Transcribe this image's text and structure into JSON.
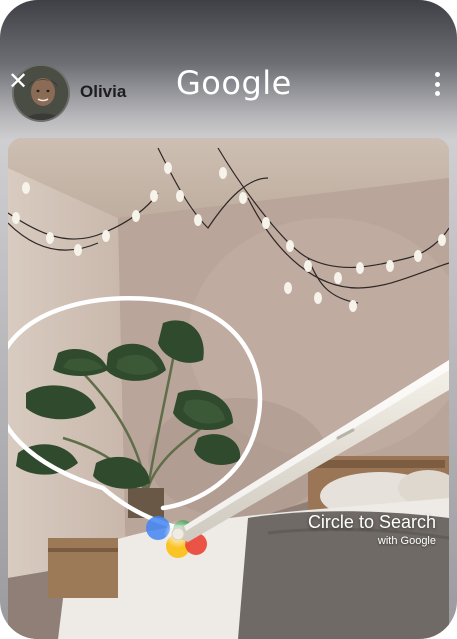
{
  "header": {
    "close_icon": "close-icon",
    "user_name": "Olivia",
    "logo_text": "Google",
    "more_icon": "more-vert-icon"
  },
  "badge": {
    "title": "Circle to Search",
    "subtitle": "with Google"
  },
  "colors": {
    "google_blue": "#4285F4",
    "google_red": "#EA4335",
    "google_yellow": "#FBBC05",
    "google_green": "#34A853",
    "stylus": "#e9e6de"
  }
}
